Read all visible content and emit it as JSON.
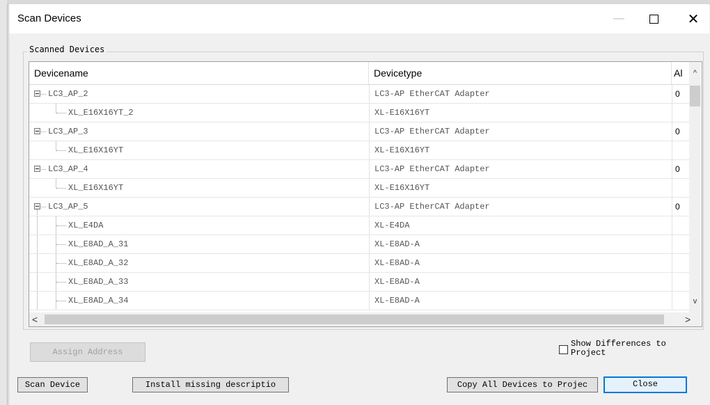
{
  "window": {
    "title": "Scan Devices",
    "minimize_glyph": "—",
    "close_glyph": "✕"
  },
  "group": {
    "label": "Scanned Devices"
  },
  "table": {
    "columns": [
      "Devicename",
      "Devicetype",
      "Al"
    ],
    "rows": [
      {
        "name": "LC3_AP_2",
        "type": "LC3-AP EtherCAT Adapter",
        "al": "0",
        "level": 0,
        "expander": true
      },
      {
        "name": "XL_E16X16YT_2",
        "type": "XL-E16X16YT",
        "al": "",
        "level": 1,
        "branch": "last"
      },
      {
        "name": "LC3_AP_3",
        "type": "LC3-AP EtherCAT Adapter",
        "al": "0",
        "level": 0,
        "expander": true
      },
      {
        "name": "XL_E16X16YT",
        "type": "XL-E16X16YT",
        "al": "",
        "level": 1,
        "branch": "last"
      },
      {
        "name": "LC3_AP_4",
        "type": "LC3-AP EtherCAT Adapter",
        "al": "0",
        "level": 0,
        "expander": true
      },
      {
        "name": "XL_E16X16YT",
        "type": "XL-E16X16YT",
        "al": "",
        "level": 1,
        "branch": "last"
      },
      {
        "name": "LC3_AP_5",
        "type": "LC3-AP EtherCAT Adapter",
        "al": "0",
        "level": 0,
        "expander": true
      },
      {
        "name": "XL_E4DA",
        "type": "XL-E4DA",
        "al": "",
        "level": 1,
        "branch": "mid"
      },
      {
        "name": "XL_E8AD_A_31",
        "type": "XL-E8AD-A",
        "al": "",
        "level": 1,
        "branch": "mid"
      },
      {
        "name": "XL_E8AD_A_32",
        "type": "XL-E8AD-A",
        "al": "",
        "level": 1,
        "branch": "mid"
      },
      {
        "name": "XL_E8AD_A_33",
        "type": "XL-E8AD-A",
        "al": "",
        "level": 1,
        "branch": "mid"
      },
      {
        "name": "XL_E8AD_A_34",
        "type": "XL-E8AD-A",
        "al": "",
        "level": 1,
        "branch": "mid"
      }
    ]
  },
  "scrollbars": {
    "up_glyph": "^",
    "down_glyph": "v",
    "left_glyph": "<",
    "right_glyph": ">"
  },
  "buttons": {
    "assign_address": "Assign Address",
    "scan_device": "Scan Device",
    "install_missing": "Install missing descriptio",
    "copy_all": "Copy All Devices to Projec",
    "close": "Close"
  },
  "checkbox": {
    "label": "Show Differences to Project",
    "checked": false
  },
  "colors": {
    "default_button_border": "#0078d7",
    "grid_border": "#a0a0a0"
  }
}
